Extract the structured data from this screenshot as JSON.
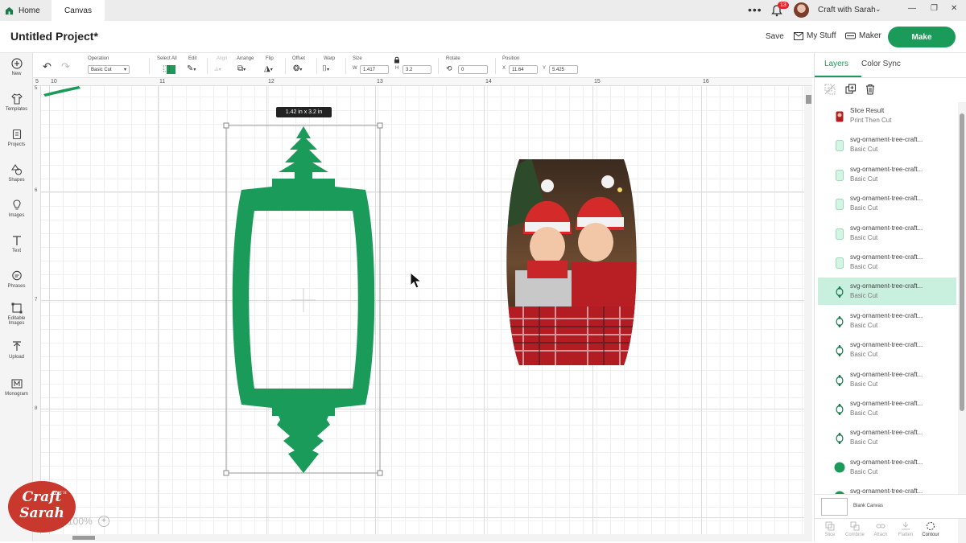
{
  "top_bar": {
    "home_tab": "Home",
    "canvas_tab": "Canvas",
    "notification_count": "13",
    "user_name": "Craft with Sarah"
  },
  "header": {
    "project_title": "Untitled Project*",
    "save": "Save",
    "my_stuff": "My Stuff",
    "maker": "Maker",
    "make": "Make"
  },
  "left_toolbar": [
    {
      "label": "New",
      "icon": "plus-circle-icon"
    },
    {
      "label": "Templates",
      "icon": "shirt-icon"
    },
    {
      "label": "Projects",
      "icon": "projects-icon"
    },
    {
      "label": "Shapes",
      "icon": "shapes-icon"
    },
    {
      "label": "Images",
      "icon": "bulb-icon"
    },
    {
      "label": "Text",
      "icon": "text-icon"
    },
    {
      "label": "Phrases",
      "icon": "speech-bubble-icon"
    },
    {
      "label": "Editable Images",
      "icon": "editable-images-icon"
    },
    {
      "label": "Upload",
      "icon": "upload-icon"
    },
    {
      "label": "Monogram",
      "icon": "monogram-icon"
    }
  ],
  "edit_toolbar": {
    "operation_label": "Operation",
    "operation_value": "Basic Cut",
    "operation_color": "#1a9b5a",
    "select_all": "Select All",
    "edit": "Edit",
    "align": "Align",
    "arrange": "Arrange",
    "flip": "Flip",
    "offset": "Offset",
    "warp": "Warp",
    "size_label": "Size",
    "w_label": "W",
    "w_value": "1.417",
    "h_label": "H",
    "h_value": "3.2",
    "rotate_label": "Rotate",
    "rotate_value": "0",
    "position_label": "Position",
    "x_label": "X",
    "x_value": "11.64",
    "y_label": "Y",
    "y_value": "5.425"
  },
  "canvas": {
    "ruler_top": [
      "5",
      "10",
      "11",
      "12",
      "13",
      "14",
      "15",
      "16"
    ],
    "ruler_left": [
      "5",
      "6",
      "7",
      "8"
    ],
    "size_tooltip": "1.42  in x 3.2  in",
    "zoom": "100%",
    "shape_color": "#1a9b5a",
    "logo_line1": "Craft",
    "logo_with": "WITH",
    "logo_line2": "Sarah"
  },
  "right_panel": {
    "tab_layers": "Layers",
    "tab_color_sync": "Color Sync",
    "layers": [
      {
        "name": "Slice Result",
        "type": "Print Then Cut",
        "thumb": "photo"
      },
      {
        "name": "svg-ornament-tree-craft...",
        "type": "Basic Cut",
        "thumb": "rect-light"
      },
      {
        "name": "svg-ornament-tree-craft...",
        "type": "Basic Cut",
        "thumb": "rect-light"
      },
      {
        "name": "svg-ornament-tree-craft...",
        "type": "Basic Cut",
        "thumb": "rect-light"
      },
      {
        "name": "svg-ornament-tree-craft...",
        "type": "Basic Cut",
        "thumb": "rect-light"
      },
      {
        "name": "svg-ornament-tree-craft...",
        "type": "Basic Cut",
        "thumb": "rect-light"
      },
      {
        "name": "svg-ornament-tree-craft...",
        "type": "Basic Cut",
        "thumb": "ornament",
        "selected": true
      },
      {
        "name": "svg-ornament-tree-craft...",
        "type": "Basic Cut",
        "thumb": "ornament"
      },
      {
        "name": "svg-ornament-tree-craft...",
        "type": "Basic Cut",
        "thumb": "ornament"
      },
      {
        "name": "svg-ornament-tree-craft...",
        "type": "Basic Cut",
        "thumb": "ornament"
      },
      {
        "name": "svg-ornament-tree-craft...",
        "type": "Basic Cut",
        "thumb": "ornament"
      },
      {
        "name": "svg-ornament-tree-craft...",
        "type": "Basic Cut",
        "thumb": "ornament"
      },
      {
        "name": "svg-ornament-tree-craft...",
        "type": "Basic Cut",
        "thumb": "circle"
      },
      {
        "name": "svg-ornament-tree-craft...",
        "type": "Basic Cut",
        "thumb": "circle"
      }
    ],
    "blank_canvas": "Blank Canvas",
    "bottom_actions": [
      {
        "label": "Slice",
        "active": false
      },
      {
        "label": "Combine",
        "active": false
      },
      {
        "label": "Attach",
        "active": false
      },
      {
        "label": "Flatten",
        "active": false
      },
      {
        "label": "Contour",
        "active": true
      }
    ]
  }
}
